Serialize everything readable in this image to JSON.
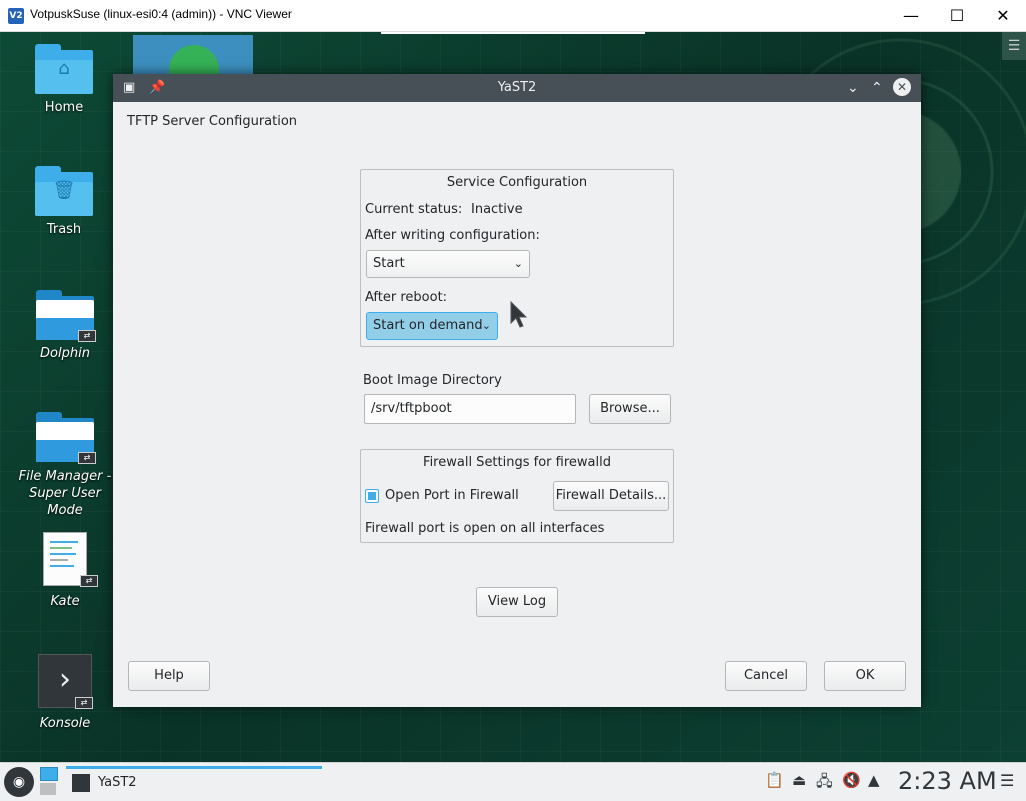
{
  "vnc": {
    "title": "VotpuskSuse (linux-esi0:4 (admin)) - VNC Viewer",
    "logo": "V2",
    "minimize": "—",
    "maximize": "☐",
    "close": "✕"
  },
  "desktop": {
    "icons": [
      {
        "label": "Home"
      },
      {
        "label": "Trash"
      },
      {
        "label": "Dolphin"
      },
      {
        "label": "File Manager - Super User Mode"
      },
      {
        "label": "Kate"
      },
      {
        "label": "Konsole"
      }
    ]
  },
  "dialog": {
    "title": "YaST2",
    "heading": "TFTP Server Configuration",
    "service": {
      "group_title": "Service Configuration",
      "status_label": "Current status:",
      "status_value": "Inactive",
      "after_writing_label": "After writing configuration:",
      "after_writing_value": "Start",
      "after_reboot_label": "After reboot:",
      "after_reboot_value": "Start on demand"
    },
    "boot": {
      "label": "Boot Image Directory",
      "value": "/srv/tftpboot",
      "browse": "Browse..."
    },
    "firewall": {
      "group_title": "Firewall Settings for firewalld",
      "open_port_label": "Open Port in Firewall",
      "open_port_checked": true,
      "details_button": "Firewall Details...",
      "status_text": "Firewall port is open on all interfaces"
    },
    "view_log": "View Log",
    "help": "Help",
    "cancel": "Cancel",
    "ok": "OK"
  },
  "taskbar": {
    "task_label": "YaST2",
    "clock": "2:23 AM"
  },
  "colors": {
    "accent": "#3daee9",
    "titlebar": "#475057",
    "dialog_bg": "#eff0f1"
  }
}
